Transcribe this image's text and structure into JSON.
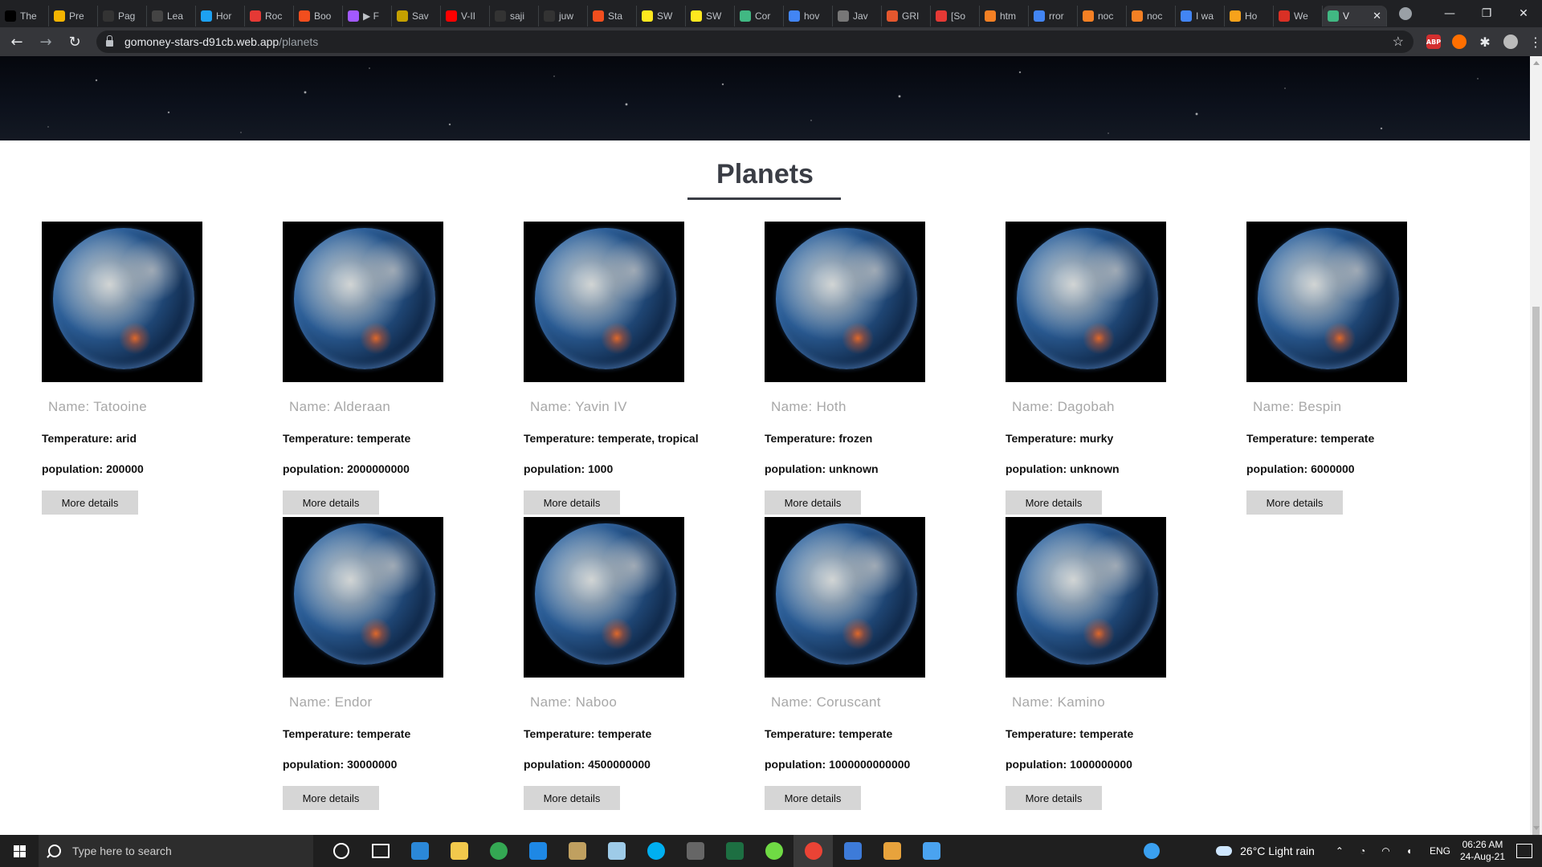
{
  "browser": {
    "tabs": [
      {
        "label": "The",
        "icon": "dev-icon",
        "color": "#000000"
      },
      {
        "label": "Pre",
        "icon": "bee-icon",
        "color": "#f4b400"
      },
      {
        "label": "Pag",
        "icon": "github-icon",
        "color": "#333333"
      },
      {
        "label": "Lea",
        "icon": "a-icon",
        "color": "#444444"
      },
      {
        "label": "Hor",
        "icon": "twitter-icon",
        "color": "#1da1f2"
      },
      {
        "label": "Roc",
        "icon": "rocket-icon",
        "color": "#e53935"
      },
      {
        "label": "Boo",
        "icon": "figma-icon",
        "color": "#f24e1e"
      },
      {
        "label": "▶ F",
        "icon": "figma-icon",
        "color": "#a259ff"
      },
      {
        "label": "Sav",
        "icon": "bee-icon",
        "color": "#c4a000"
      },
      {
        "label": "V-II",
        "icon": "youtube-icon",
        "color": "#ff0000"
      },
      {
        "label": "saji",
        "icon": "github-icon",
        "color": "#333333"
      },
      {
        "label": "juw",
        "icon": "github-icon",
        "color": "#333333"
      },
      {
        "label": "Sta",
        "icon": "figma-icon",
        "color": "#f24e1e"
      },
      {
        "label": "SW",
        "icon": "sw-icon",
        "color": "#ffe81f"
      },
      {
        "label": "SW",
        "icon": "sw-icon",
        "color": "#ffe81f"
      },
      {
        "label": "Cor",
        "icon": "vue-icon",
        "color": "#41b883"
      },
      {
        "label": "hov",
        "icon": "google-icon",
        "color": "#4285f4"
      },
      {
        "label": "Jav",
        "icon": "google-icon",
        "color": "#777777"
      },
      {
        "label": "GRI",
        "icon": "shield-icon",
        "color": "#e4572e"
      },
      {
        "label": "[So",
        "icon": "asterisk-icon",
        "color": "#e53935"
      },
      {
        "label": "htm",
        "icon": "stackoverflow-icon",
        "color": "#f48024"
      },
      {
        "label": "rror",
        "icon": "google-icon",
        "color": "#4285f4"
      },
      {
        "label": "noc",
        "icon": "stackoverflow-icon",
        "color": "#f48024"
      },
      {
        "label": "noc",
        "icon": "stackoverflow-icon",
        "color": "#f48024"
      },
      {
        "label": "I wa",
        "icon": "google-icon",
        "color": "#4285f4"
      },
      {
        "label": "Ho",
        "icon": "codepen-icon",
        "color": "#f7a21b"
      },
      {
        "label": "We",
        "icon": "gmail-icon",
        "color": "#d93025"
      }
    ],
    "active_tab": {
      "label": "V",
      "icon": "vue-icon",
      "color": "#41b883"
    },
    "url_host": "gomoney-stars-d91cb.web.app",
    "url_path": "/planets"
  },
  "page": {
    "heading": "Planets"
  },
  "planets": [
    {
      "name": "Name: Tatooine",
      "temperature": "Temperature: arid",
      "population": "population: 200000",
      "button": "More details"
    },
    {
      "name": "Name: Alderaan",
      "temperature": "Temperature: temperate",
      "population": "population: 2000000000",
      "button": "More details"
    },
    {
      "name": "Name: Yavin IV",
      "temperature": "Temperature: temperate, tropical",
      "population": "population: 1000",
      "button": "More details"
    },
    {
      "name": "Name: Hoth",
      "temperature": "Temperature: frozen",
      "population": "population: unknown",
      "button": "More details"
    },
    {
      "name": "Name: Dagobah",
      "temperature": "Temperature: murky",
      "population": "population: unknown",
      "button": "More details"
    },
    {
      "name": "Name: Bespin",
      "temperature": "Temperature: temperate",
      "population": "population: 6000000",
      "button": "More details"
    },
    {
      "name": "Name: Endor",
      "temperature": "Temperature: temperate",
      "population": "population: 30000000",
      "button": "More details"
    },
    {
      "name": "Name: Naboo",
      "temperature": "Temperature: temperate",
      "population": "population: 4500000000",
      "button": "More details"
    },
    {
      "name": "Name: Coruscant",
      "temperature": "Temperature: temperate",
      "population": "population: 1000000000000",
      "button": "More details"
    },
    {
      "name": "Name: Kamino",
      "temperature": "Temperature: temperate",
      "population": "population: 1000000000",
      "button": "More details"
    }
  ],
  "taskbar": {
    "search_placeholder": "Type here to search",
    "weather": "26°C  Light rain",
    "language": "ENG",
    "time": "06:26 AM",
    "date": "24-Aug-21"
  }
}
